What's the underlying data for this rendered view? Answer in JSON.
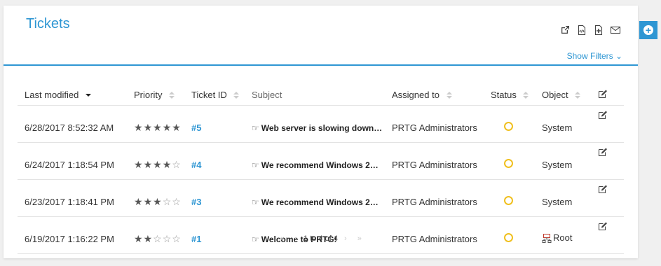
{
  "header": {
    "title": "Tickets",
    "show_filters": "Show Filters ⌄"
  },
  "toolbar": {
    "icons": [
      "external-link-icon",
      "html-export-icon",
      "add-document-icon",
      "email-icon"
    ]
  },
  "table": {
    "columns": [
      "Last modified",
      "Priority",
      "Ticket ID",
      "Subject",
      "Assigned to",
      "Status",
      "Object"
    ],
    "rows": [
      {
        "modified": "6/28/2017 8:52:32 AM",
        "priority": 5,
        "id": "#5",
        "subject": "Web server is slowing down…",
        "assigned": "PRTG Administrators",
        "status": "open",
        "object": "System"
      },
      {
        "modified": "6/24/2017 1:18:54 PM",
        "priority": 4,
        "id": "#4",
        "subject": "We recommend Windows 2…",
        "assigned": "PRTG Administrators",
        "status": "open",
        "object": "System"
      },
      {
        "modified": "6/23/2017 1:18:41 PM",
        "priority": 3,
        "id": "#3",
        "subject": "We recommend Windows 2…",
        "assigned": "PRTG Administrators",
        "status": "open",
        "object": "System"
      },
      {
        "modified": "6/19/2017 1:16:22 PM",
        "priority": 2,
        "id": "#1",
        "subject": "Welcome to PRTG!",
        "assigned": "PRTG Administrators",
        "status": "open",
        "object": "Root"
      }
    ]
  },
  "pager": {
    "first": "«",
    "prev": "‹",
    "text": "1 to 4 of 4",
    "next": "›",
    "last": "»"
  },
  "colors": {
    "accent": "#2e96d3",
    "status_open": "#f0c020"
  }
}
